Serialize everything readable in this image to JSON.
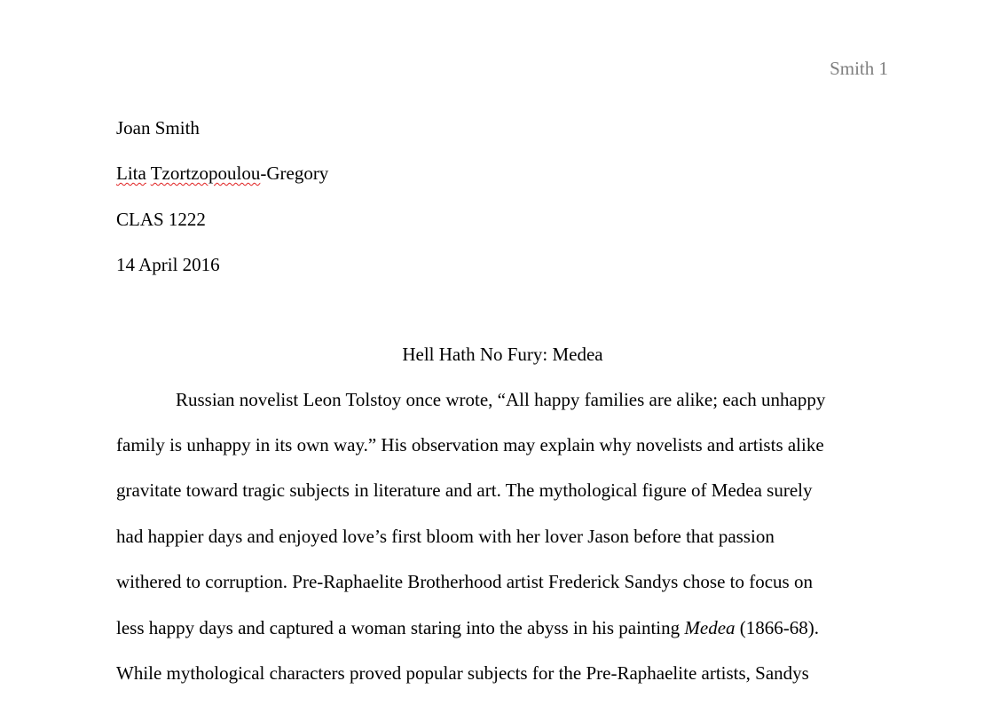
{
  "header": {
    "page_number_label": "Smith 1"
  },
  "heading_block": {
    "student_name": "Joan Smith",
    "instructor_first": "Lita",
    "instructor_middle": "Tzortzopoulou",
    "instructor_last": "-Gregory",
    "course": "CLAS 1222",
    "date": "14 April 2016"
  },
  "document": {
    "title": "Hell Hath No Fury: Medea",
    "lines": [
      "Russian novelist Leon Tolstoy once wrote, “All happy families are alike; each unhappy",
      "family is unhappy in its own way.” His observation may explain why novelists and artists alike",
      "gravitate toward tragic subjects in literature and art. The mythological figure of Medea surely",
      "had happier days and enjoyed love’s first bloom with her lover Jason before that passion",
      "withered to corruption. Pre-Raphaelite Brotherhood artist Frederick Sandys chose to focus on"
    ],
    "line6_before": "less happy days and captured a woman staring into the abyss in his painting ",
    "line6_italic": "Medea",
    "line6_after": " (1866-68).",
    "line7": "While mythological characters proved popular subjects for the Pre-Raphaelite artists, Sandys"
  },
  "colors": {
    "text": "#000000",
    "header_text": "#7f7f7f",
    "spellcheck_underline": "#e02020"
  }
}
